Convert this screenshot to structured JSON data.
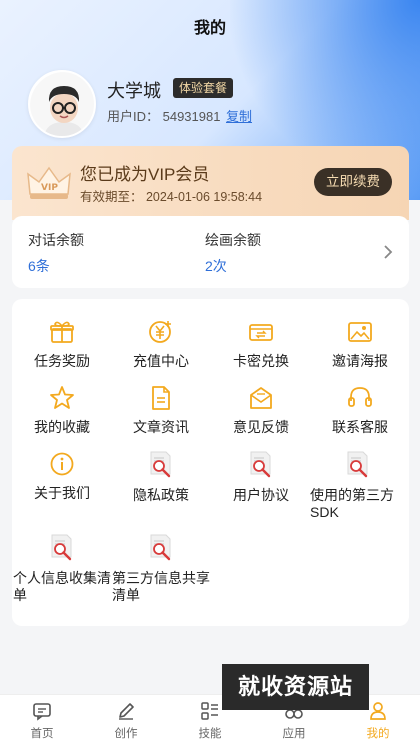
{
  "header": {
    "title": "我的"
  },
  "user": {
    "name": "大学城",
    "plan_badge": "体验套餐",
    "uid_text": "用户ID：  54931981",
    "copy_label": "复制"
  },
  "vip": {
    "title": "您已成为VIP会员",
    "expiry": "有效期至：  2024-01-06 19:58:44",
    "renew_label": "立即续费",
    "crown_text": "VIP"
  },
  "balance": {
    "chat_label": "对话余额",
    "chat_value": "6条",
    "draw_label": "绘画余额",
    "draw_value": "2次"
  },
  "menu": [
    {
      "label": "任务奖励",
      "icon": "gift-icon"
    },
    {
      "label": "充值中心",
      "icon": "yuan-coin-icon"
    },
    {
      "label": "卡密兑换",
      "icon": "card-exchange-icon"
    },
    {
      "label": "邀请海报",
      "icon": "image-icon"
    },
    {
      "label": "我的收藏",
      "icon": "star-icon"
    },
    {
      "label": "文章资讯",
      "icon": "article-icon"
    },
    {
      "label": "意见反馈",
      "icon": "feedback-mail-icon"
    },
    {
      "label": "联系客服",
      "icon": "headset-icon"
    },
    {
      "label": "关于我们",
      "icon": "info-icon"
    },
    {
      "label": "隐私政策",
      "icon": "document-search-icon"
    },
    {
      "label": "用户协议",
      "icon": "document-search-icon"
    },
    {
      "label": "使用的第三方SDK",
      "icon": "document-search-icon"
    },
    {
      "label": "个人信息收集清单",
      "icon": "document-search-icon"
    },
    {
      "label": "第三方信息共享清单",
      "icon": "document-search-icon"
    }
  ],
  "tabs": [
    {
      "label": "首页",
      "icon": "chat-bubble-icon"
    },
    {
      "label": "创作",
      "icon": "pen-icon"
    },
    {
      "label": "技能",
      "icon": "grid-list-icon"
    },
    {
      "label": "应用",
      "icon": "infinity-icon"
    },
    {
      "label": "我的",
      "icon": "person-icon"
    }
  ],
  "watermark": "就收资源站",
  "colors": {
    "accent_gold": "#f3a91f",
    "link_blue": "#2f6fd8",
    "vip_bg": "#f6d5b4",
    "badge_dark": "#2c2c2c"
  }
}
